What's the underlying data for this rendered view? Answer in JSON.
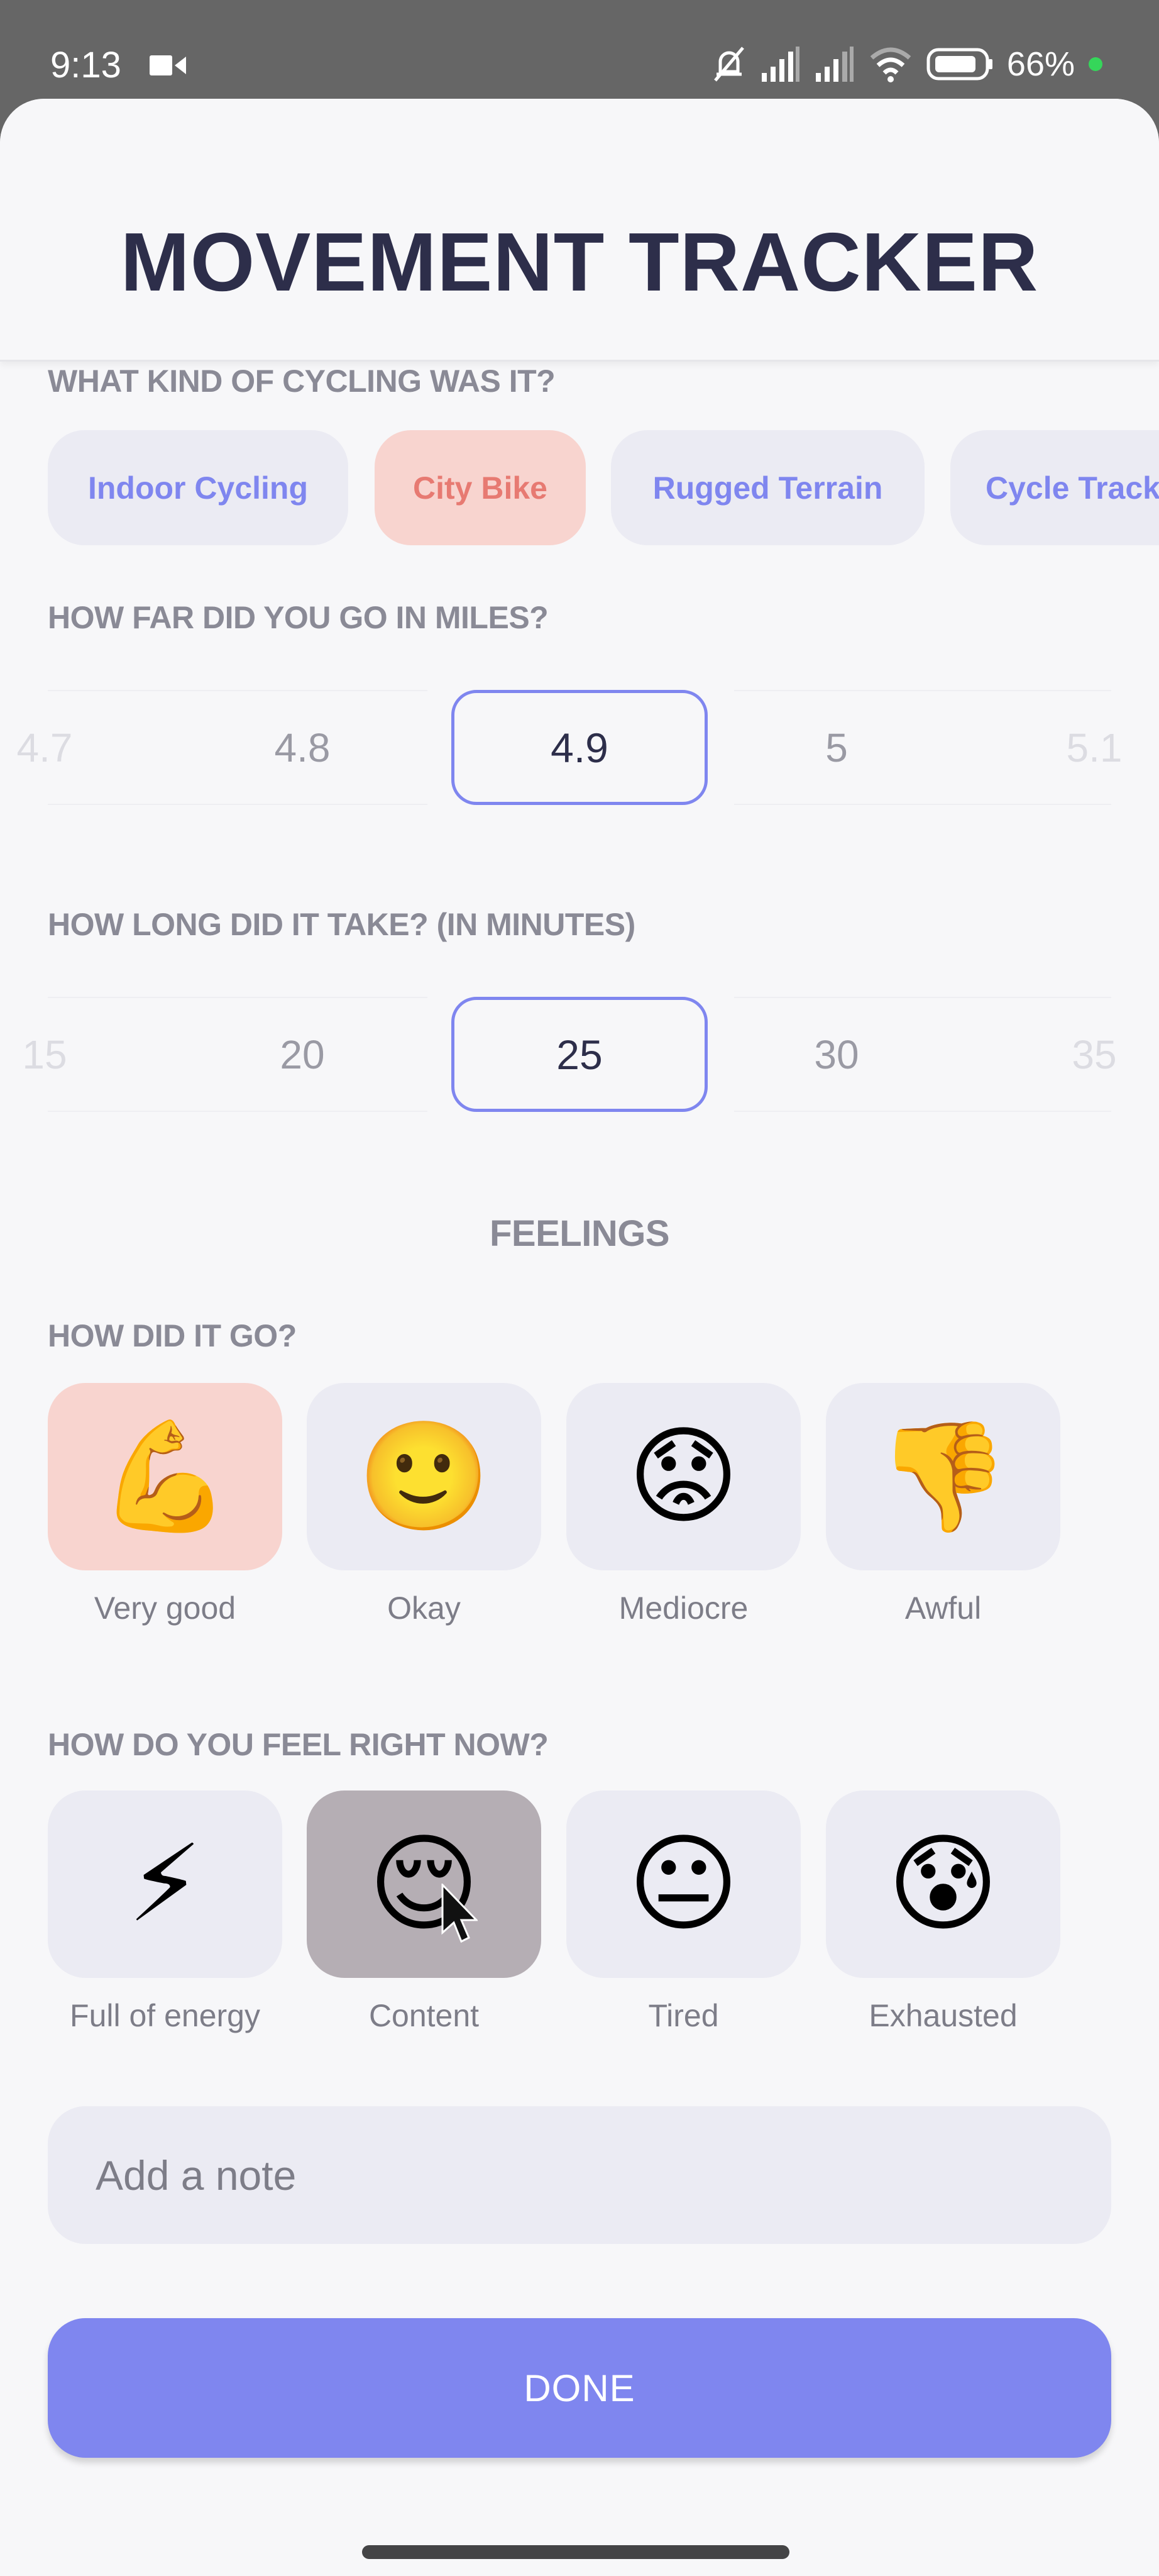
{
  "status_bar": {
    "time": "9:13",
    "battery_percent": "66%",
    "icons": [
      "video-camera-icon",
      "silent-bell-icon",
      "signal-icon",
      "signal-icon",
      "wifi-icon",
      "battery-icon"
    ]
  },
  "header": {
    "title": "MOVEMENT TRACKER"
  },
  "cycling_type": {
    "label": "WHAT KIND OF CYCLING WAS IT?",
    "options": [
      {
        "label": "Indoor Cycling",
        "selected": false
      },
      {
        "label": "City Bike",
        "selected": true
      },
      {
        "label": "Rugged Terrain",
        "selected": false
      },
      {
        "label": "Cycle Track",
        "selected": false
      }
    ],
    "selected_color": "#e77a72",
    "option_color": "#7f86ef"
  },
  "distance": {
    "label": "HOW FAR DID YOU GO IN MILES?",
    "values": [
      "4.7",
      "4.8",
      "4.9",
      "5",
      "5.1"
    ],
    "selected": "4.9"
  },
  "duration": {
    "label": "HOW LONG DID IT TAKE? (IN MINUTES)",
    "values": [
      "15",
      "20",
      "25",
      "30",
      "35"
    ],
    "selected": "25"
  },
  "feelings": {
    "heading": "FEELINGS",
    "how_did_it_go": {
      "label": "HOW DID IT GO?",
      "options": [
        {
          "emoji": "💪",
          "icon": "flexed-biceps-icon",
          "label": "Very good",
          "selected": true
        },
        {
          "emoji": "🙂",
          "icon": "slightly-smiling-face-icon",
          "label": "Okay",
          "selected": false
        },
        {
          "emoji": "😟",
          "icon": "worried-face-icon",
          "label": "Mediocre",
          "selected": false
        },
        {
          "emoji": "👎",
          "icon": "thumbs-down-icon",
          "label": "Awful",
          "selected": false
        }
      ]
    },
    "feel_now": {
      "label": "HOW DO YOU FEEL RIGHT NOW?",
      "options": [
        {
          "emoji": "⚡",
          "icon": "lightning-icon",
          "label": "Full of energy",
          "pressed": false
        },
        {
          "emoji": "😌",
          "icon": "relieved-face-icon",
          "label": "Content",
          "pressed": true
        },
        {
          "emoji": "😐",
          "icon": "neutral-face-icon",
          "label": "Tired",
          "pressed": false
        },
        {
          "emoji": "😰",
          "icon": "anxious-sweat-face-icon",
          "label": "Exhausted",
          "pressed": false
        }
      ]
    }
  },
  "note": {
    "placeholder": "Add a note",
    "value": ""
  },
  "done_button": {
    "label": "DONE",
    "color": "#7f86ef"
  }
}
